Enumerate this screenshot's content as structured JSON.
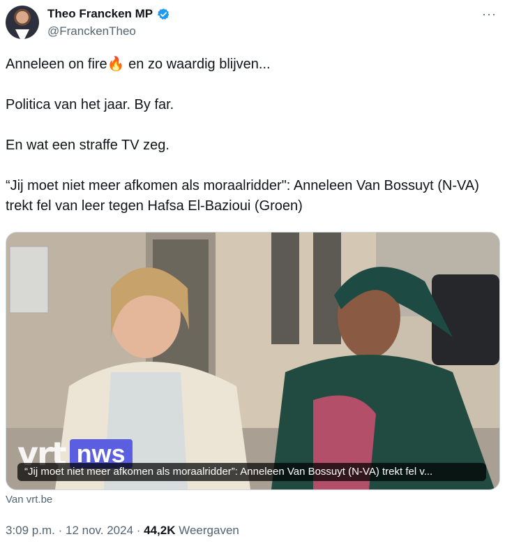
{
  "author": {
    "display_name": "Theo Francken MP",
    "handle": "@FranckenTheo",
    "verified_color": "#1d9bf0"
  },
  "more_icon": "more-horizontal-icon",
  "tweet": {
    "line1_before": "Anneleen on fire",
    "line1_emoji": "🔥",
    "line1_after": " en zo waardig blijven...",
    "line2": "Politica van het jaar. By far.",
    "line3": "En wat een straffe TV zeg.",
    "line4": "“Jij moet niet meer afkomen als moraalridder\": Anneleen Van Bossuyt (N-VA) trekt fel van leer tegen Hafsa El-Bazioui (Groen)"
  },
  "media": {
    "logo_vrt": "vrt",
    "logo_nws": "nws",
    "caption": "“Jij moet niet meer afkomen als moraalridder”: Anneleen Van Bossuyt (N-VA) trekt fel v..."
  },
  "source": "Van vrt.be",
  "meta": {
    "time": "3:09 p.m.",
    "sep1": " · ",
    "date": "12 nov. 2024",
    "sep2": " · ",
    "views": "44,2K",
    "views_label": " Weergaven"
  }
}
